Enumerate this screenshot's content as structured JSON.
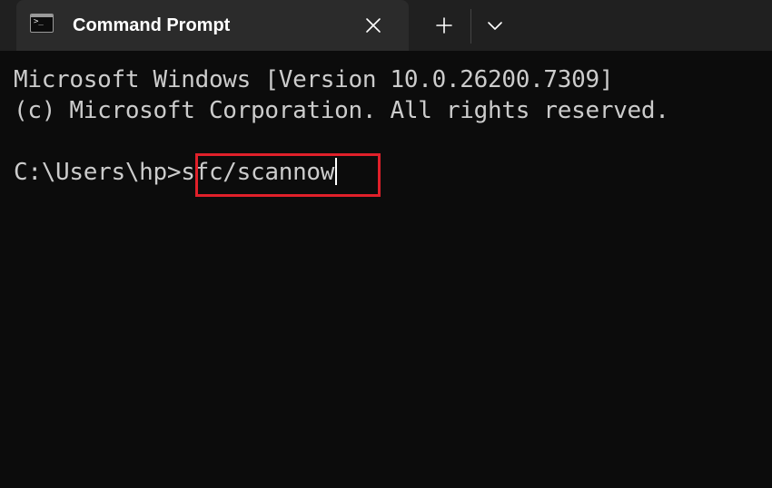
{
  "window": {
    "tab_title": "Command Prompt",
    "tab_icon": "cmd-prompt-icon",
    "icons": {
      "close": "close-icon",
      "new_tab": "plus-icon",
      "dropdown": "chevron-down-icon"
    }
  },
  "console": {
    "banner_line1": "Microsoft Windows [Version 10.0.26200.7309]",
    "banner_line2": "(c) Microsoft Corporation. All rights reserved.",
    "prompt": "C:\\Users\\hp>",
    "command": "sfc/scannow"
  },
  "colors": {
    "background": "#0c0c0c",
    "tabbar": "#202020",
    "tab_active": "#2b2b2b",
    "text": "#cccccc",
    "highlight": "#e0202a"
  }
}
